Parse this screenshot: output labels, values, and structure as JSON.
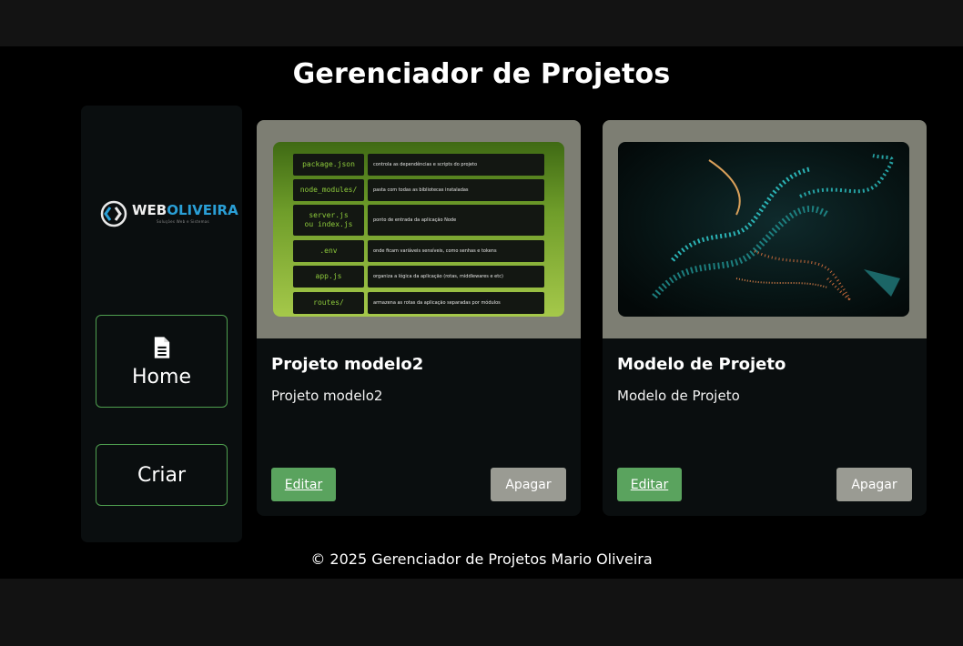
{
  "page": {
    "title": "Gerenciador de Projetos"
  },
  "sidebar": {
    "logo": {
      "part1": "WEB",
      "part2": "OLIVEIRA",
      "tagline": "Soluções Web e Sistemas"
    },
    "items": [
      {
        "label": "Home",
        "icon": "document-icon"
      },
      {
        "label": "Criar"
      }
    ]
  },
  "projects": [
    {
      "title": "Projeto modelo2",
      "description": "Projeto modelo2",
      "edit_label": "Editar",
      "delete_label": "Apagar",
      "thumbnail": {
        "rows": [
          {
            "key": "package.json",
            "value": "controla as dependências e scripts do projeto"
          },
          {
            "key": "node_modules/",
            "value": "pasta com todas as bibliotecas instaladas"
          },
          {
            "key": "server.js\nou index.js",
            "value": "ponto de entrada da aplicação Node"
          },
          {
            "key": ".env",
            "value": "onde ficam variáveis sensíveis, como senhas e tokens"
          },
          {
            "key": "app.js",
            "value": "organiza a lógica da aplicação (rotas, middlewares e etc)"
          },
          {
            "key": "routes/",
            "value": "armazena as rotas da aplicação separadas por módulos"
          }
        ]
      }
    },
    {
      "title": "Modelo de Projeto",
      "description": "Modelo de Projeto",
      "edit_label": "Editar",
      "delete_label": "Apagar"
    }
  ],
  "footer": {
    "text": "© 2025 Gerenciador de Projetos Mario Oliveira"
  },
  "colors": {
    "accent_green": "#5aa35e",
    "border_green": "#4f9f4f",
    "delete_gray": "#9a9b93",
    "logo_blue": "#2a9fd6"
  }
}
